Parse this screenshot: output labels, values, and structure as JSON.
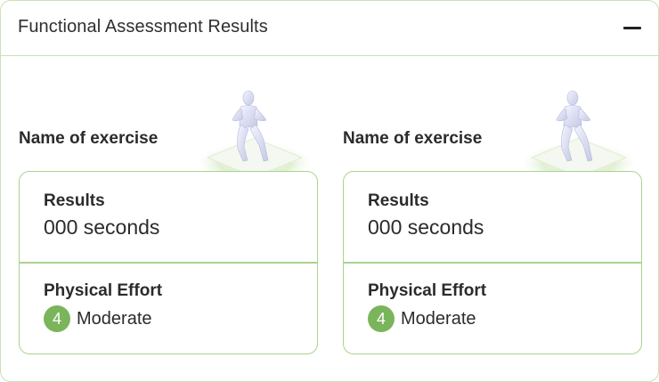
{
  "panel": {
    "title": "Functional Assessment Results",
    "collapse_icon": "minus-icon"
  },
  "exercises": [
    {
      "name": "Name of exercise",
      "figure_icon": "exercise-figure-icon",
      "results_label": "Results",
      "results_value": "000 seconds",
      "effort_label": "Physical Effort",
      "effort_level": "4",
      "effort_text": "Moderate"
    },
    {
      "name": "Name of exercise",
      "figure_icon": "exercise-figure-icon",
      "results_label": "Results",
      "results_value": "000 seconds",
      "effort_label": "Physical Effort",
      "effort_level": "4",
      "effort_text": "Moderate"
    }
  ],
  "colors": {
    "panel_border": "#c9e2b6",
    "card_border": "#a9d48e",
    "badge": "#7ab55c",
    "text": "#2b2b2b"
  }
}
